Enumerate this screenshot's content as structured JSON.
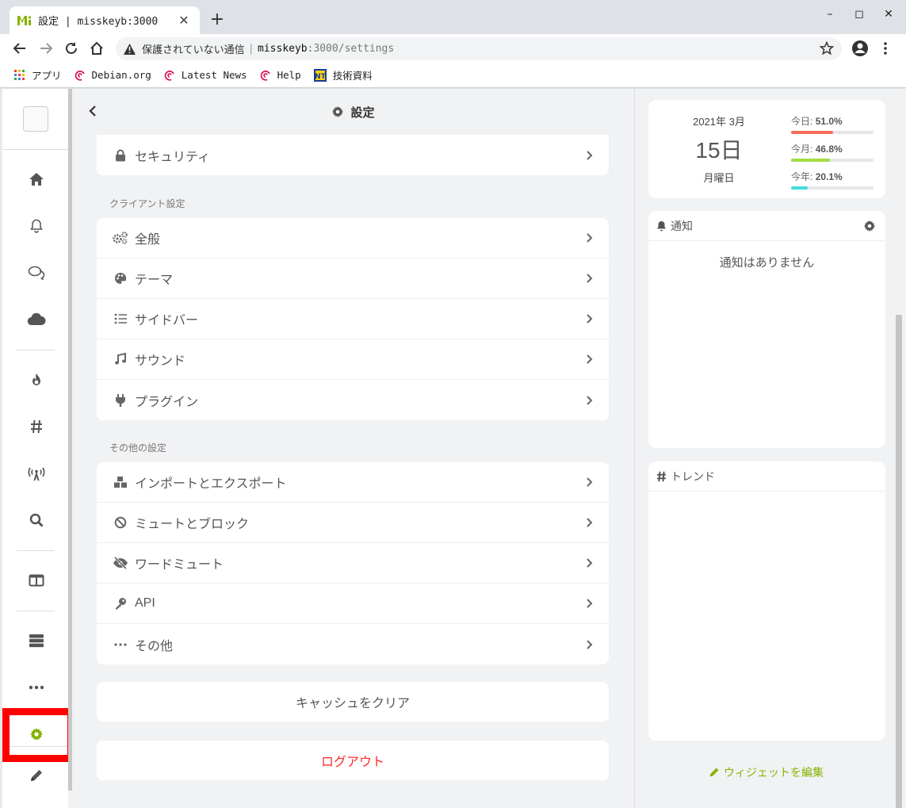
{
  "browser": {
    "tab_title": "設定 | misskeyb:3000",
    "omnibox": {
      "security_text": "保護されていない通信",
      "host": "misskeyb",
      "path": ":3000/settings"
    },
    "bookmarks": [
      {
        "label": "アプリ",
        "icon": "apps-grid-icon"
      },
      {
        "label": "Debian.org",
        "icon": "debian-icon"
      },
      {
        "label": "Latest News",
        "icon": "debian-icon"
      },
      {
        "label": "Help",
        "icon": "debian-icon"
      },
      {
        "label": "技術資料",
        "icon": "nt-icon"
      }
    ]
  },
  "header": {
    "title": "設定"
  },
  "security_row": {
    "label": "セキュリティ",
    "icon": "lock-icon"
  },
  "client_section": {
    "label": "クライアント設定",
    "items": [
      {
        "label": "全般",
        "icon": "cogs-icon"
      },
      {
        "label": "テーマ",
        "icon": "palette-icon"
      },
      {
        "label": "サイドバー",
        "icon": "list-icon"
      },
      {
        "label": "サウンド",
        "icon": "music-icon"
      },
      {
        "label": "プラグイン",
        "icon": "plug-icon"
      }
    ]
  },
  "other_section": {
    "label": "その他の設定",
    "items": [
      {
        "label": "インポートとエクスポート",
        "icon": "boxes-icon"
      },
      {
        "label": "ミュートとブロック",
        "icon": "ban-icon"
      },
      {
        "label": "ワードミュート",
        "icon": "eye-slash-icon"
      },
      {
        "label": "API",
        "icon": "key-icon"
      },
      {
        "label": "その他",
        "icon": "ellipsis-icon"
      }
    ]
  },
  "actions": {
    "clear_cache": "キャッシュをクリア",
    "logout": "ログアウト"
  },
  "calendar": {
    "year_month": "2021年 3月",
    "day": "15日",
    "weekday": "月曜日",
    "stats": [
      {
        "label": "今日:",
        "value": "51.0%",
        "percent": 51.0,
        "color": "#f76d5e"
      },
      {
        "label": "今月:",
        "value": "46.8%",
        "percent": 46.8,
        "color": "#a1de41"
      },
      {
        "label": "今年:",
        "value": "20.1%",
        "percent": 20.1,
        "color": "#41ddde"
      }
    ]
  },
  "notifications": {
    "title": "通知",
    "empty": "通知はありません"
  },
  "trends": {
    "title": "トレンド"
  },
  "edit_widgets": "ウィジェットを編集",
  "colors": {
    "accent": "#86b300",
    "danger": "#ff2a2a",
    "highlight": "#ff0000"
  }
}
